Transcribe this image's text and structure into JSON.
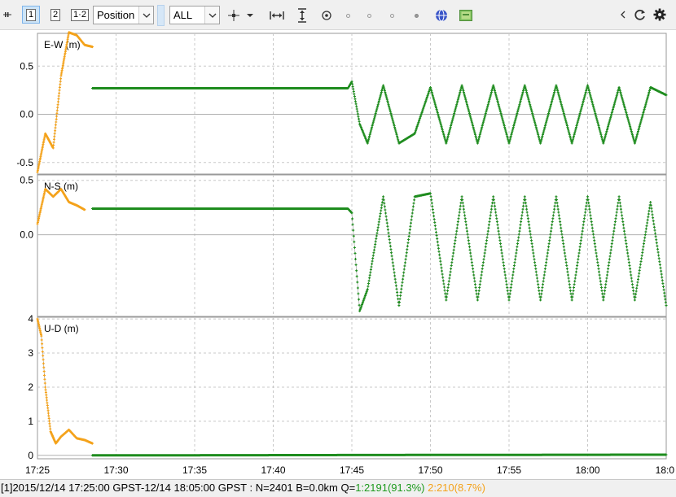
{
  "toolbar": {
    "plot_type_button_1": "1",
    "plot_type_button_2": "2",
    "plot_type_button_12": "1·2",
    "plot_mode": "Position",
    "quality_filter": "ALL"
  },
  "colors": {
    "quality_1": "#1e8c1e",
    "quality_2": "#f4a21a",
    "grid": "#c8c8c8",
    "toolbar_bg": "#f0f0f0"
  },
  "chart_data": [
    {
      "type": "scatter",
      "title": "E-W (m)",
      "ylim": [
        -0.62,
        0.84
      ],
      "y_ticks": [
        0.5,
        0.0,
        -0.5
      ],
      "y_tick_labels": [
        "0.5",
        "0.0",
        "-0.5"
      ],
      "grid": true,
      "series": [
        {
          "name": "1:2191(91.3%)",
          "color": "#1e8c1e",
          "x": [
            "17:28:30",
            "17:44:45",
            "17:45:00",
            "17:45:30",
            "17:46:00",
            "17:47:00",
            "17:48:00",
            "17:49:00",
            "17:50:00",
            "17:51:00",
            "17:52:00",
            "17:53:00",
            "17:54:00",
            "17:55:00",
            "17:56:00",
            "17:57:00",
            "17:58:00",
            "17:59:00",
            "18:00:00",
            "18:01:00",
            "18:02:00",
            "18:03:00",
            "18:04:00",
            "18:05:00"
          ],
          "y": [
            0.27,
            0.27,
            0.34,
            -0.1,
            -0.3,
            0.3,
            -0.3,
            -0.2,
            0.28,
            -0.3,
            0.3,
            -0.3,
            0.3,
            -0.3,
            0.3,
            -0.3,
            0.3,
            -0.3,
            0.3,
            -0.3,
            0.28,
            -0.3,
            0.28,
            0.2
          ]
        },
        {
          "name": "2:210(8.7%)",
          "color": "#f4a21a",
          "x": [
            "17:25:00",
            "17:25:30",
            "17:26:00",
            "17:26:30",
            "17:27:00",
            "17:27:30",
            "17:28:00",
            "17:28:30"
          ],
          "y": [
            -0.6,
            -0.2,
            -0.35,
            0.4,
            0.85,
            0.82,
            0.72,
            0.7
          ]
        }
      ]
    },
    {
      "type": "scatter",
      "title": "N-S (m)",
      "ylim": [
        -0.75,
        0.55
      ],
      "y_ticks": [
        0.5,
        0.0
      ],
      "y_tick_labels": [
        "0.5",
        "0.0"
      ],
      "grid": true,
      "series": [
        {
          "name": "1:2191(91.3%)",
          "color": "#1e8c1e",
          "x": [
            "17:28:30",
            "17:44:45",
            "17:45:00",
            "17:45:30",
            "17:46:00",
            "17:47:00",
            "17:48:00",
            "17:49:00",
            "17:50:00",
            "17:51:00",
            "17:52:00",
            "17:53:00",
            "17:54:00",
            "17:55:00",
            "17:56:00",
            "17:57:00",
            "17:58:00",
            "17:59:00",
            "18:00:00",
            "18:01:00",
            "18:02:00",
            "18:03:00",
            "18:04:00",
            "18:05:00"
          ],
          "y": [
            0.24,
            0.24,
            0.2,
            -0.7,
            -0.5,
            0.35,
            -0.65,
            0.35,
            0.38,
            -0.6,
            0.35,
            -0.6,
            0.35,
            -0.6,
            0.35,
            -0.6,
            0.35,
            -0.6,
            0.35,
            -0.6,
            0.35,
            -0.6,
            0.3,
            -0.65
          ]
        },
        {
          "name": "2:210(8.7%)",
          "color": "#f4a21a",
          "x": [
            "17:25:00",
            "17:25:30",
            "17:26:00",
            "17:26:30",
            "17:27:00",
            "17:27:30",
            "17:28:00"
          ],
          "y": [
            0.1,
            0.42,
            0.35,
            0.42,
            0.3,
            0.27,
            0.23
          ]
        }
      ]
    },
    {
      "type": "scatter",
      "title": "U-D (m)",
      "ylim": [
        -0.1,
        4.05
      ],
      "y_ticks": [
        4,
        3,
        2,
        1,
        0
      ],
      "y_tick_labels": [
        "4",
        "3",
        "2",
        "1",
        "0"
      ],
      "x_ticks": [
        "17:25",
        "17:30",
        "17:35",
        "17:40",
        "17:45",
        "17:50",
        "17:55",
        "18:00",
        "18:0"
      ],
      "xlim_minutes": [
        0,
        40
      ],
      "grid": true,
      "series": [
        {
          "name": "1:2191(91.3%)",
          "color": "#1e8c1e",
          "x": [
            "17:28:30",
            "18:05:00"
          ],
          "y": [
            0.0,
            0.02
          ]
        },
        {
          "name": "2:210(8.7%)",
          "color": "#f4a21a",
          "x": [
            "17:25:00",
            "17:25:15",
            "17:25:30",
            "17:25:50",
            "17:26:10",
            "17:26:30",
            "17:27:00",
            "17:27:30",
            "17:28:00",
            "17:28:30"
          ],
          "y": [
            4.0,
            3.5,
            2.0,
            0.7,
            0.35,
            0.55,
            0.75,
            0.5,
            0.45,
            0.35
          ]
        }
      ]
    }
  ],
  "status": {
    "prefix": "[1]2015/12/14 17:25:00 GPST-12/14 18:05:00 GPST : N=2401 B=0.0km Q=",
    "q1": "1:2191(91.3%)",
    "q2": "2:210(8.7%)"
  }
}
